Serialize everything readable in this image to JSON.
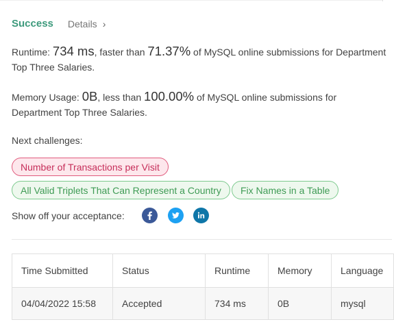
{
  "header": {
    "status": "Success",
    "details_label": "Details",
    "chevron_glyph": "›"
  },
  "runtime": {
    "label": "Runtime: ",
    "value": "734 ms",
    "middle": ", faster than ",
    "percent": "71.37%",
    "suffix": " of MySQL online submissions for Department Top Three Salaries."
  },
  "memory": {
    "label": "Memory Usage: ",
    "value": "0B",
    "middle": ", less than ",
    "percent": "100.00%",
    "suffix": " of MySQL online submissions for Department Top Three Salaries."
  },
  "next": {
    "label": "Next challenges:",
    "challenges": [
      "Number of Transactions per Visit",
      "All Valid Triplets That Can Represent a Country",
      "Fix Names in a Table"
    ]
  },
  "share": {
    "label": "Show off your acceptance:",
    "icons": [
      "facebook-icon",
      "twitter-icon",
      "linkedin-icon"
    ]
  },
  "table": {
    "headers": [
      "Time Submitted",
      "Status",
      "Runtime",
      "Memory",
      "Language"
    ],
    "rows": [
      [
        "04/04/2022 15:58",
        "Accepted",
        "734 ms",
        "0B",
        "mysql"
      ]
    ]
  },
  "colors": {
    "success": "#3d9a7c",
    "chip_red": "#e05a7c",
    "chip_green": "#7cc98d",
    "facebook": "#3b5998",
    "twitter": "#1da1f2",
    "linkedin": "#0e76a8"
  }
}
